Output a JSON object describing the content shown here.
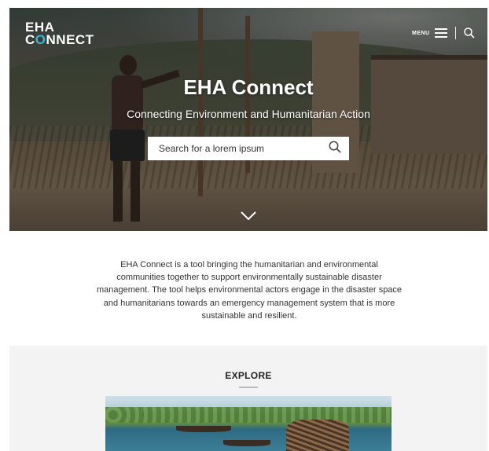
{
  "header": {
    "logo_line1": "EHA",
    "logo_c": "C",
    "logo_o": "O",
    "logo_rest": "NNECT",
    "menu_label": "MENU"
  },
  "hero": {
    "title": "EHA Connect",
    "subtitle": "Connecting Environment and Humanitarian Action",
    "search_placeholder": "Search for a lorem ipsum"
  },
  "intro": {
    "text": "EHA Connect is a tool bringing the humanitarian and environmental communities together to support environmentally sustainable disaster management. The tool helps environmental actors engage in the disaster space and humanitarians towards an emergency management system that is more sustainable and resilient."
  },
  "explore": {
    "heading": "EXPLORE"
  },
  "icons": {
    "menu": "hamburger-icon",
    "search": "search-icon",
    "scroll": "chevron-down-icon"
  },
  "colors": {
    "logo_accent": "#38b6d8",
    "explore_bg": "#f3f3f3"
  }
}
